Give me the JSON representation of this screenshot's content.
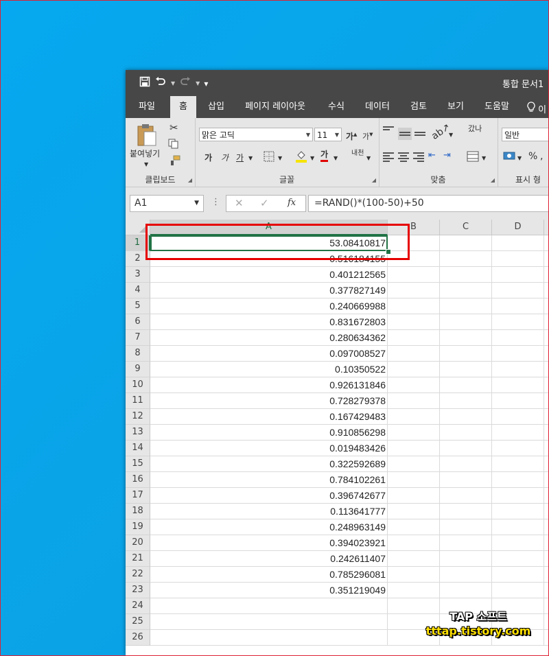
{
  "window": {
    "title": "통합 문서1"
  },
  "qat": {
    "save_icon": "save-icon",
    "undo_icon": "undo-icon",
    "redo_icon": "redo-icon",
    "customize": "customize-icon"
  },
  "tabs": [
    "파일",
    "홈",
    "삽입",
    "페이지 레이아웃",
    "수식",
    "데이터",
    "검토",
    "보기",
    "도움말"
  ],
  "tell_me": "이",
  "ribbon": {
    "clipboard": {
      "label": "클립보드",
      "paste": "붙여넣기"
    },
    "font": {
      "label": "글꼴",
      "font_name": "맑은 고딕",
      "font_size": "11",
      "bold": "가",
      "italic": "가",
      "underline": "가",
      "grow": "가",
      "shrink": "가",
      "font_color": "가",
      "phonetic": "내천"
    },
    "alignment": {
      "label": "맞춤",
      "wrap": "갔나"
    },
    "number": {
      "label": "표시 형",
      "format": "일반",
      "percent": "%"
    }
  },
  "formula_bar": {
    "name_box": "A1",
    "cancel": "✕",
    "enter": "✓",
    "fx": "fx",
    "formula": "=RAND()*(100-50)+50"
  },
  "columns": [
    "A",
    "B",
    "C",
    "D"
  ],
  "rows": [
    "1",
    "2",
    "3",
    "4",
    "5",
    "6",
    "7",
    "8",
    "9",
    "10",
    "11",
    "12",
    "13",
    "14",
    "15",
    "16",
    "17",
    "18",
    "19",
    "20",
    "21",
    "22",
    "23",
    "24",
    "25",
    "26"
  ],
  "cells_a": [
    "53.08410817",
    "0.516184155",
    "0.401212565",
    "0.377827149",
    "0.240669988",
    "0.831672803",
    "0.280634362",
    "0.097008527",
    "0.10350522",
    "0.926131846",
    "0.728279378",
    "0.167429483",
    "0.910856298",
    "0.019483426",
    "0.322592689",
    "0.784102261",
    "0.396742677",
    "0.113641777",
    "0.248963149",
    "0.394023921",
    "0.242611407",
    "0.785296081",
    "0.351219049",
    "",
    "",
    ""
  ],
  "watermark": {
    "line1": "TAP 소프트",
    "line2": "tttap.tistory.com"
  },
  "colors": {
    "accent": "#217346",
    "annotation": "#e60000",
    "desktop": "#0aa3e6"
  }
}
